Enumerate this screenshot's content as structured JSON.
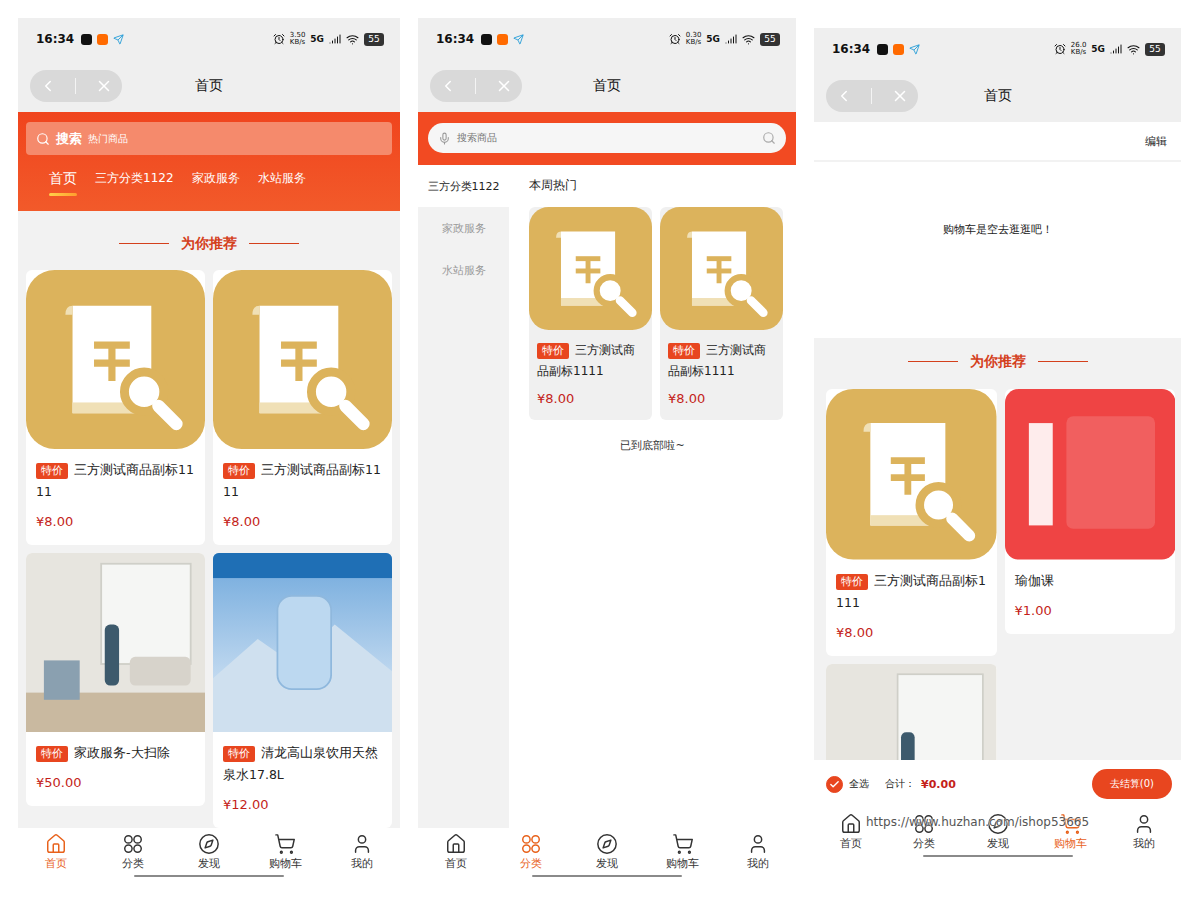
{
  "home_screen": {
    "status": {
      "time": "16:34",
      "speed": "3.50",
      "speed_unit": "KB/s",
      "network": "5G",
      "battery": "55"
    },
    "title": "首页",
    "search": {
      "label": "搜索",
      "placeholder": "热门商品"
    },
    "tabs": [
      {
        "label": "首页",
        "selected": true
      },
      {
        "label": "三方分类1122",
        "selected": false
      },
      {
        "label": "家政服务",
        "selected": false
      },
      {
        "label": "水站服务",
        "selected": false
      }
    ],
    "section_title": "为你推荐",
    "products": [
      {
        "kind": "receipt",
        "tag": "特价",
        "title": "三方测试商品副标1111",
        "price": "¥8.00"
      },
      {
        "kind": "receipt",
        "tag": "特价",
        "title": "三方测试商品副标1111",
        "price": "¥8.00"
      },
      {
        "kind": "room",
        "tag": "特价",
        "title": "家政服务-大扫除",
        "price": "¥50.00"
      },
      {
        "kind": "water",
        "tag": "特价",
        "title": "清龙高山泉饮用天然泉水17.8L",
        "price": "¥12.00"
      }
    ],
    "tabbar": [
      {
        "label": "首页",
        "selected": true
      },
      {
        "label": "分类",
        "selected": false
      },
      {
        "label": "发现",
        "selected": false
      },
      {
        "label": "购物车",
        "selected": false
      },
      {
        "label": "我的",
        "selected": false
      }
    ]
  },
  "category_screen": {
    "status": {
      "time": "16:34",
      "speed": "0.30",
      "speed_unit": "KB/s",
      "network": "5G",
      "battery": "55"
    },
    "title": "首页",
    "search": {
      "placeholder": "搜索商品"
    },
    "sidebar": [
      {
        "label": "三方分类1122",
        "selected": true
      },
      {
        "label": "家政服务",
        "selected": false
      },
      {
        "label": "水站服务",
        "selected": false
      }
    ],
    "heading": "本周热门",
    "products": [
      {
        "kind": "receipt",
        "tag": "特价",
        "title": "三方测试商品副标1111",
        "price": "¥8.00"
      },
      {
        "kind": "receipt",
        "tag": "特价",
        "title": "三方测试商品副标1111",
        "price": "¥8.00"
      }
    ],
    "end_text": "已到底部啦~",
    "tabbar": [
      {
        "label": "首页",
        "selected": false
      },
      {
        "label": "分类",
        "selected": true
      },
      {
        "label": "发现",
        "selected": false
      },
      {
        "label": "购物车",
        "selected": false
      },
      {
        "label": "我的",
        "selected": false
      }
    ]
  },
  "cart_screen": {
    "status": {
      "time": "16:34",
      "speed": "26.0",
      "speed_unit": "KB/s",
      "network": "5G",
      "battery": "55"
    },
    "title": "首页",
    "edit": "编辑",
    "empty_text": "购物车是空去逛逛吧！",
    "section_title": "为你推荐",
    "products": [
      {
        "kind": "receipt",
        "tag": "特价",
        "title": "三方测试商品副标1111",
        "price": "¥8.00"
      },
      {
        "kind": "logo",
        "title": "瑜伽课",
        "price": "¥1.00"
      },
      {
        "kind": "room"
      }
    ],
    "checkout": {
      "select_all": {
        "label": "全选",
        "checked": true
      },
      "total_label": "合计：",
      "total": "¥0.00",
      "button": "去结算(0)"
    },
    "tabbar": [
      {
        "label": "首页",
        "selected": false
      },
      {
        "label": "分类",
        "selected": false
      },
      {
        "label": "发现",
        "selected": false
      },
      {
        "label": "购物车",
        "selected": true
      },
      {
        "label": "我的",
        "selected": false
      }
    ],
    "watermark": "https://www.huzhan.com/ishop53665"
  }
}
